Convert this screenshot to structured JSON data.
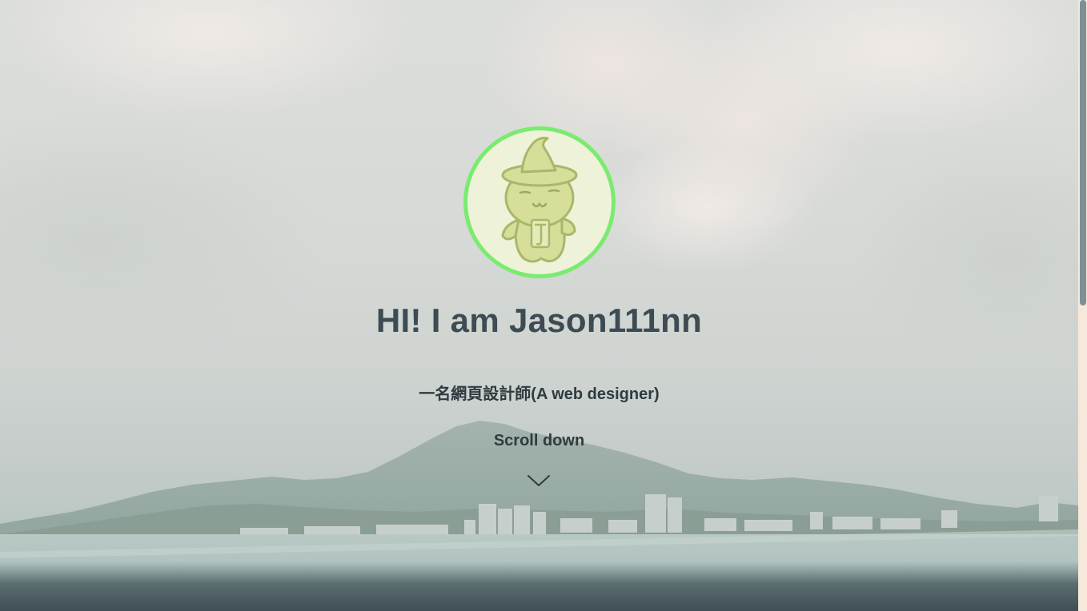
{
  "hero": {
    "title": "HI! I am Jason111nn",
    "subtitle": "一名網頁設計師(A web designer)",
    "scroll_label": "Scroll down",
    "scroll_icon": "chevron-down-icon",
    "avatar_description": "avatar"
  },
  "colors": {
    "avatar_border": "#7aeb70",
    "title_text": "#3d4c53",
    "body_text": "#2f3b40",
    "scroll_thumb": "#7b9197",
    "scroll_track": "#f7e8dc"
  },
  "scrollbar": {
    "position_fraction": 0.0,
    "visible_fraction": 0.5
  }
}
